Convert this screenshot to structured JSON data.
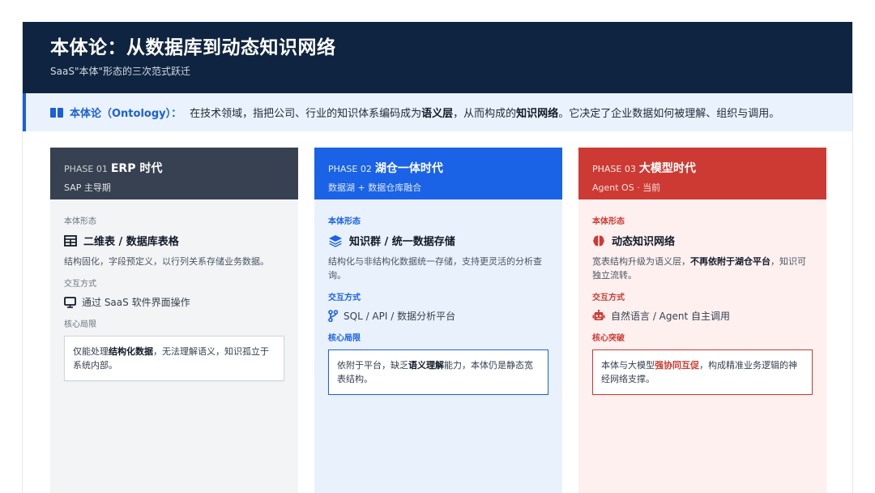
{
  "header": {
    "title": "本体论：从数据库到动态知识网络",
    "subtitle": "SaaS\"本体\"形态的三次范式跃迁"
  },
  "definition": {
    "term": "本体论（Ontology）：",
    "text_1": "在技术领域，指把公司、行业的知识体系编码成为",
    "bold_1": "语义层",
    "text_2": "，从而构成的",
    "bold_2": "知识网络",
    "text_3": "。它决定了企业数据如何被理解、组织与调用。"
  },
  "phases": [
    {
      "phase": "PHASE 01",
      "name": "ERP 时代",
      "caption": "SAP 主导期",
      "form_label": "本体形态",
      "form_title": "二维表 / 数据库表格",
      "form_icon": "table-icon",
      "form_desc": "结构固化，字段预定义，以行列关系存储业务数据。",
      "interaction_label": "交互方式",
      "interaction_icon": "monitor-icon",
      "interaction_text": "通过 SaaS 软件界面操作",
      "box_label": "核心局限",
      "box_text_1": "仅能处理",
      "box_bold": "结构化数据",
      "box_text_2": "，无法理解语义，知识孤立于系统内部。"
    },
    {
      "phase": "PHASE 02",
      "name": "湖仓一体时代",
      "caption": "数据湖 + 数据仓库融合",
      "form_label": "本体形态",
      "form_title": "知识群 / 统一数据存储",
      "form_icon": "layers-icon",
      "form_desc": "结构化与非结构化数据统一存储，支持更灵活的分析查询。",
      "interaction_label": "交互方式",
      "interaction_icon": "branch-icon",
      "interaction_text": "SQL / API / 数据分析平台",
      "box_label": "核心局限",
      "box_text_1": "依附于平台，缺乏",
      "box_bold": "语义理解",
      "box_text_2": "能力，本体仍是静态宽表结构。"
    },
    {
      "phase": "PHASE 03",
      "name": "大模型时代",
      "caption": "Agent OS · 当前",
      "form_label": "本体形态",
      "form_title": "动态知识网络",
      "form_icon": "brain-icon",
      "form_desc_1": "宽表结构升级为语义层，",
      "form_desc_bold": "不再依附于湖仓平台",
      "form_desc_2": "，知识可独立流转。",
      "interaction_label": "交互方式",
      "interaction_icon": "robot-icon",
      "interaction_text": "自然语言 / Agent 自主调用",
      "box_label": "核心突破",
      "box_text_1": "本体与大模型",
      "box_bold": "强协同互促",
      "box_text_2": "，构成精准业务逻辑的神经网络支撑。"
    }
  ],
  "colors": {
    "header_bg": "#0f2440",
    "accent_blue": "#1a62e6",
    "accent_red": "#cd3a33",
    "phase1_head": "#374151"
  }
}
